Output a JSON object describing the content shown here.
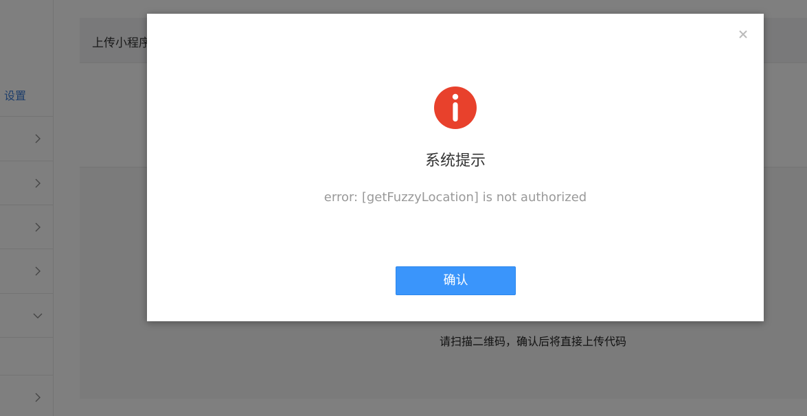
{
  "background": {
    "sidebar": {
      "active_link": "设置",
      "items": [
        {
          "chevron": "right"
        },
        {
          "chevron": "right"
        },
        {
          "chevron": "right"
        },
        {
          "chevron": "right"
        },
        {
          "chevron": "down"
        },
        {
          "chevron": "right"
        }
      ]
    },
    "main": {
      "title": "上传小程序",
      "scan_hint": "请扫描二维码，确认后将直接上传代码"
    }
  },
  "dialog": {
    "icon": "alert-info-icon",
    "title": "系统提示",
    "message": "error: [getFuzzyLocation] is not authorized",
    "confirm_label": "确认",
    "close_icon": "close-icon"
  },
  "colors": {
    "accent": "#3a95fb",
    "alert_red": "#e8412c",
    "link_blue": "#3a7bd5"
  }
}
